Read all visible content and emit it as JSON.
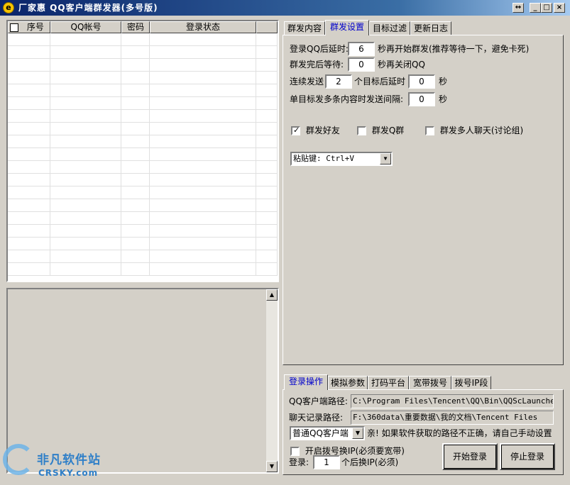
{
  "window": {
    "title": "厂家惠   QQ客户端群发器(多号版)",
    "app_icon": "e",
    "restore_glyph": "↔",
    "min_glyph": "_",
    "max_glyph": "□",
    "close_glyph": "×"
  },
  "grid": {
    "headers": [
      "序号",
      "QQ帐号",
      "密码",
      "登录状态"
    ],
    "select_all_checked": false,
    "rows": []
  },
  "log": {
    "text": "",
    "scroll_up": "▲",
    "scroll_down": "▼"
  },
  "top_tabs": {
    "items": [
      "群发内容",
      "群发设置",
      "目标过滤",
      "更新日志"
    ],
    "active": "群发设置"
  },
  "settings": {
    "login_delay_label": "登录QQ后延时:",
    "login_delay_value": "6",
    "login_delay_suffix": "秒再开始群发(推荐等待一下，避免卡死)",
    "after_send_label": "群发完后等待:",
    "after_send_value": "0",
    "after_send_suffix": "秒再关闭QQ",
    "consecutive_label": "连续发送",
    "consecutive_value": "2",
    "consecutive_mid": "个目标后延时",
    "consecutive_delay_value": "0",
    "consecutive_unit": "秒",
    "interval_label": "单目标发多条内容时发送间隔:",
    "interval_value": "0",
    "interval_unit": "秒",
    "send_friends_label": "群发好友",
    "send_friends_checked": true,
    "send_groups_label": "群发Q群",
    "send_groups_checked": false,
    "send_multi_label": "群发多人聊天(讨论组)",
    "send_multi_checked": false,
    "paste_key": "粘贴键: Ctrl+V",
    "check_mark": "✓",
    "dropdown_glyph": "▼"
  },
  "bottom_tabs": {
    "items": [
      "登录操作",
      "模拟参数",
      "打码平台",
      "宽带拨号",
      "拨号IP段"
    ],
    "active": "登录操作"
  },
  "login": {
    "client_path_label": "QQ客户端路径:",
    "client_path_value": "C:\\Program Files\\Tencent\\QQ\\Bin\\QQScLauncher.ex",
    "chat_path_label": "聊天记录路径:",
    "chat_path_value": "F:\\360data\\重要数据\\我的文档\\Tencent Files",
    "client_type": "普通QQ客户端",
    "path_hint": "亲! 如果软件获取的路径不正确，请自己手动设置",
    "dial_label": "开启拨号换IP(必须要宽带)",
    "dial_checked": false,
    "login_label": "登录:",
    "login_count": "1",
    "login_suffix": "个后换IP(必须)",
    "start_button": "开始登录",
    "stop_button": "停止登录"
  },
  "watermark": {
    "cn": "非凡软件站",
    "en": "CRSKY.com"
  }
}
